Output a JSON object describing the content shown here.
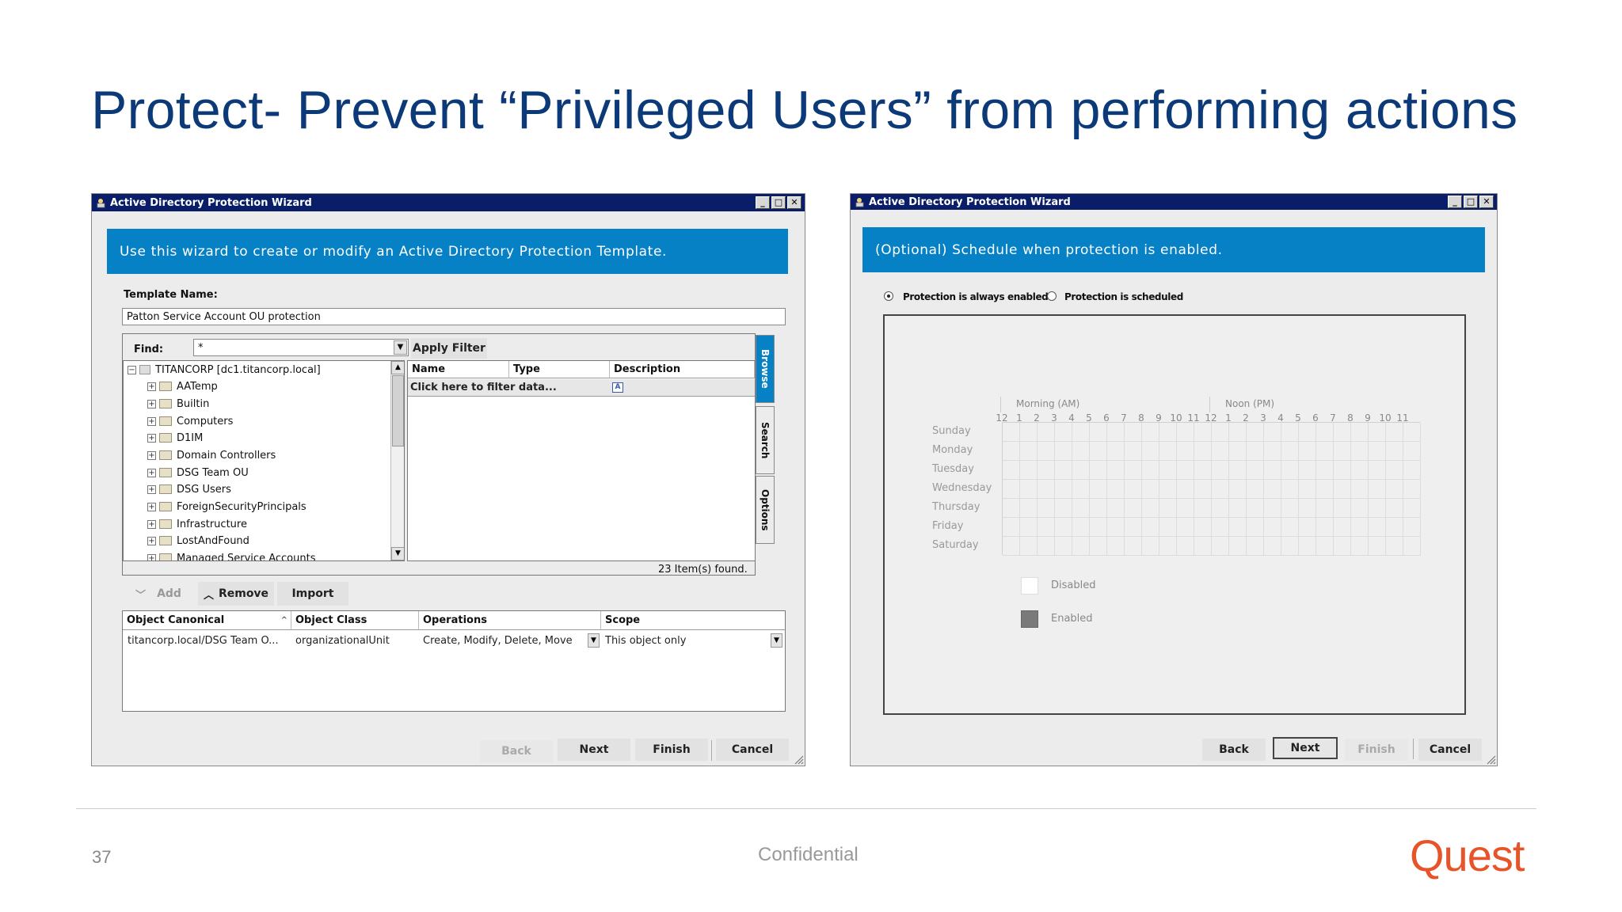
{
  "slide": {
    "title": "Protect- Prevent “Privileged Users” from performing actions",
    "page_number": "37",
    "confidential": "Confidential",
    "logo": "Quest"
  },
  "left_window": {
    "title": "Active Directory Protection Wizard",
    "title_buttons": [
      "_",
      "□",
      "✕"
    ],
    "banner": "Use this wizard to create or modify an Active Directory Protection Template.",
    "template_name_label": "Template Name:",
    "template_name_value": "Patton Service Account OU protection",
    "find_label": "Find:",
    "find_value": "*",
    "apply_filter": "Apply Filter",
    "tree_root": "TITANCORP [dc1.titancorp.local]",
    "tree_items": [
      "AATemp",
      "Builtin",
      "Computers",
      "D1IM",
      "Domain Controllers",
      "DSG Team OU",
      "DSG Users",
      "ForeignSecurityPrincipals",
      "Infrastructure",
      "LostAndFound",
      "Managed Service Accounts"
    ],
    "result_columns": [
      "Name",
      "Type",
      "Description"
    ],
    "filter_row": "Click here to filter data...",
    "items_found": "23   Item(s) found.",
    "tabs": [
      "Browse",
      "Search",
      "Options"
    ],
    "toolbar": {
      "add": "Add",
      "remove": "Remove",
      "import": "Import"
    },
    "grid_columns": [
      "Object Canonical",
      "Object Class",
      "Operations",
      "Scope"
    ],
    "grid_row": {
      "canonical": "titancorp.local/DSG Team O...",
      "object_class": "organizationalUnit",
      "operations": "Create, Modify, Delete, Move",
      "scope": "This object only"
    },
    "buttons": {
      "back": "Back",
      "next": "Next",
      "finish": "Finish",
      "cancel": "Cancel"
    }
  },
  "right_window": {
    "title": "Active Directory Protection Wizard",
    "title_buttons": [
      "_",
      "□",
      "✕"
    ],
    "banner": "(Optional) Schedule when protection is enabled.",
    "radio_always": "Protection is always enabled",
    "radio_scheduled": "Protection is scheduled",
    "radio_selected": "always",
    "morning_label": "Morning (AM)",
    "noon_label": "Noon (PM)",
    "hours": [
      "12",
      "1",
      "2",
      "3",
      "4",
      "5",
      "6",
      "7",
      "8",
      "9",
      "10",
      "11",
      "12",
      "1",
      "2",
      "3",
      "4",
      "5",
      "6",
      "7",
      "8",
      "9",
      "10",
      "11"
    ],
    "days": [
      "Sunday",
      "Monday",
      "Tuesday",
      "Wednesday",
      "Thursday",
      "Friday",
      "Saturday"
    ],
    "legend_disabled": "Disabled",
    "legend_enabled": "Enabled",
    "buttons": {
      "back": "Back",
      "next": "Next",
      "finish": "Finish",
      "cancel": "Cancel"
    }
  },
  "colors": {
    "title_blue": "#0c3a78",
    "banner_blue": "#0681c6",
    "titlebar_navy": "#0a1d68",
    "quest_orange": "#e8542a"
  }
}
